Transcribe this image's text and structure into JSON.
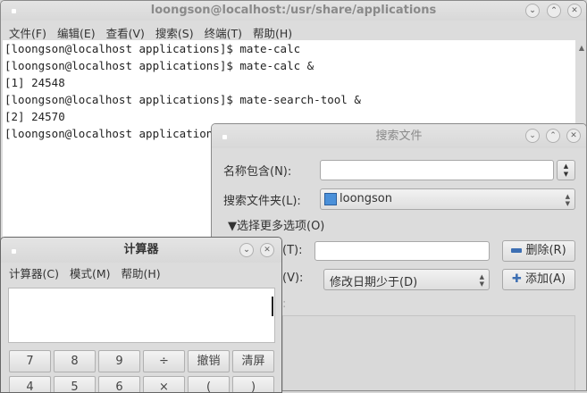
{
  "terminal": {
    "title": "loongson@localhost:/usr/share/applications",
    "menu": [
      "文件(F)",
      "编辑(E)",
      "查看(V)",
      "搜索(S)",
      "终端(T)",
      "帮助(H)"
    ],
    "lines": [
      "[loongson@localhost applications]$ mate-calc",
      "[loongson@localhost applications]$ mate-calc &",
      "[1] 24548",
      "[loongson@localhost applications]$ mate-search-tool &",
      "[2] 24570",
      "[loongson@localhost applications]$ "
    ]
  },
  "search": {
    "title": "搜索文件",
    "name_label": "名称包含(N):",
    "name_value": "",
    "folder_label": "搜索文件夹(L):",
    "folder_value": "loongson",
    "more_options": "选择更多选项(O)",
    "option_label_t": "(T):",
    "option_value_t": "",
    "option_label_v": "(V):",
    "option_select": "修改日期少于(D)",
    "remove_label": "删除(R)",
    "add_label": "添加(A)",
    "partial_label": ":"
  },
  "calc": {
    "title": "计算器",
    "menu": [
      "计算器(C)",
      "模式(M)",
      "帮助(H)"
    ],
    "display": "",
    "buttons_row1": [
      "7",
      "8",
      "9",
      "÷",
      "撤销",
      "清屏"
    ],
    "buttons_row2": [
      "4",
      "5",
      "6",
      "×",
      "(",
      ")"
    ]
  }
}
